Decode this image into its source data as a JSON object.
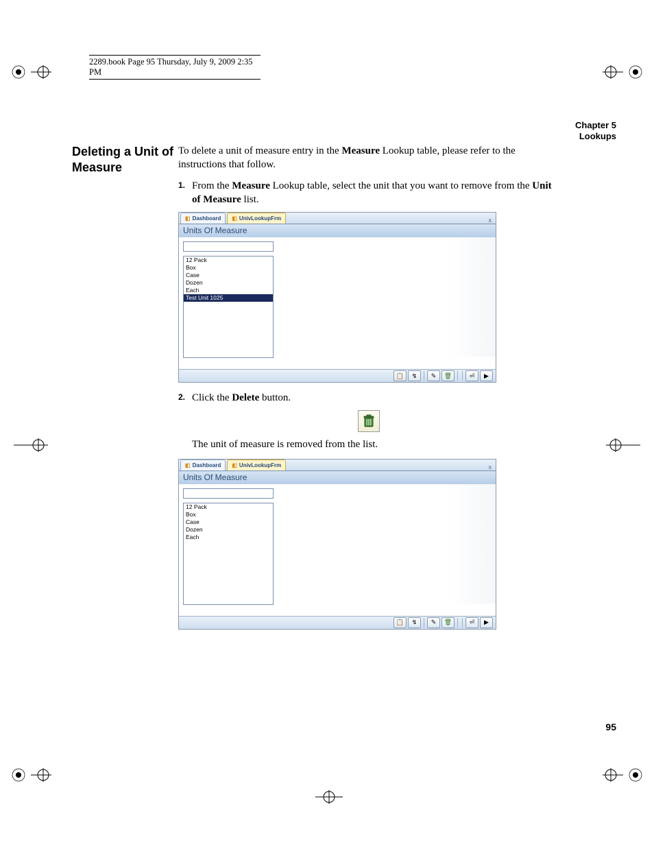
{
  "header_line": "2289.book  Page 95  Thursday, July 9, 2009  2:35 PM",
  "chapter": {
    "line1": "Chapter 5",
    "line2": "Lookups"
  },
  "section_title": "Deleting a Unit of Measure",
  "intro_1": "To delete a unit of measure entry in the ",
  "intro_bold_1": "Measure",
  "intro_2": " Lookup table, please refer to the instructions that follow.",
  "steps": {
    "s1_num": "1.",
    "s1_a": "From the ",
    "s1_b": "Measure",
    "s1_c": " Lookup table, select the unit that you want to remove from the ",
    "s1_d": "Unit of Measure",
    "s1_e": " list.",
    "s2_num": "2.",
    "s2_a": "Click the ",
    "s2_b": "Delete",
    "s2_c": " button."
  },
  "after_delete": "The unit of measure is removed from the list.",
  "figure": {
    "tab1": "Dashboard",
    "tab2": "UnivLookupFrm",
    "close": "x",
    "title": "Units Of Measure"
  },
  "list1": [
    "12 Pack",
    "Box",
    "Case",
    "Dozen",
    "Each",
    "Test Unit 1025"
  ],
  "list1_selected_index": 5,
  "list2": [
    "12 Pack",
    "Box",
    "Case",
    "Dozen",
    "Each"
  ],
  "statusbar_icons": [
    "📋",
    "↯",
    "✎",
    "🗑",
    "⏎",
    "▶"
  ],
  "page_number": "95"
}
